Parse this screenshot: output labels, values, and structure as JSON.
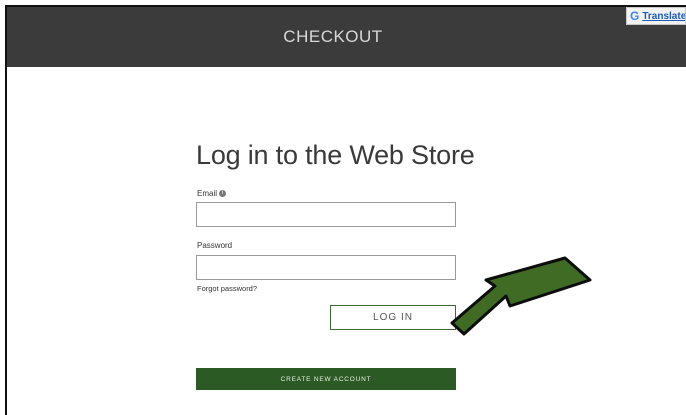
{
  "header": {
    "title": "CHECKOUT"
  },
  "translate": {
    "icon": "G",
    "label": "Translate"
  },
  "login": {
    "title": "Log in to the Web Store",
    "email_label": "Email",
    "email_value": "",
    "password_label": "Password",
    "password_value": "",
    "forgot_password": "Forgot password?",
    "login_button": "LOG IN",
    "create_account_button": "CREATE NEW ACCOUNT"
  },
  "icons": {
    "email_info": "info-icon",
    "annotation": "green-arrow-icon"
  },
  "colors": {
    "header_bg": "#3b3b3b",
    "brand_green": "#2c5a24",
    "arrow_green": "#3f6b25"
  }
}
